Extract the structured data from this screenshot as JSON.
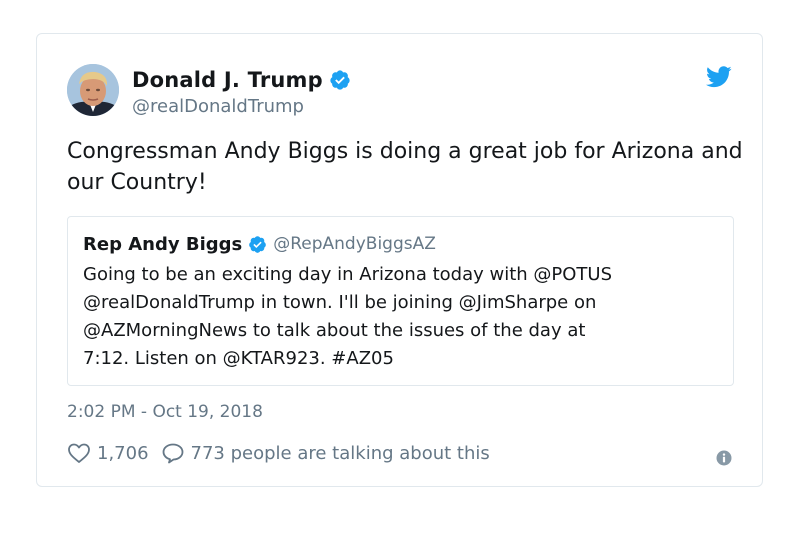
{
  "tweet": {
    "author_name": "Donald J. Trump",
    "author_handle": "@realDonaldTrump",
    "text": "Congressman Andy Biggs is doing a great job for Arizona and our Country!",
    "timestamp": "2:02 PM - Oct 19, 2018",
    "likes": "1,706",
    "replies_text": "773 people are talking about this"
  },
  "quoted": {
    "author_name": "Rep Andy Biggs",
    "author_handle": "@RepAndyBiggsAZ",
    "text_lines": [
      "Going to be an exciting day in Arizona today with @POTUS",
      "@realDonaldTrump in town. I'll be joining @JimSharpe on",
      "@AZMorningNews to talk about the issues of the day at",
      "7:12. Listen on @KTAR923. #AZ05"
    ]
  },
  "icons": {
    "avatar": "avatar-photo",
    "verified": "verified-badge-icon",
    "logo": "twitter-bird-icon",
    "like": "heart-icon",
    "reply": "speech-bubble-icon",
    "info": "info-icon"
  },
  "colors": {
    "brand": "#1da1f2",
    "text": "#14171a",
    "muted": "#657786",
    "border": "#e1e8ed"
  }
}
